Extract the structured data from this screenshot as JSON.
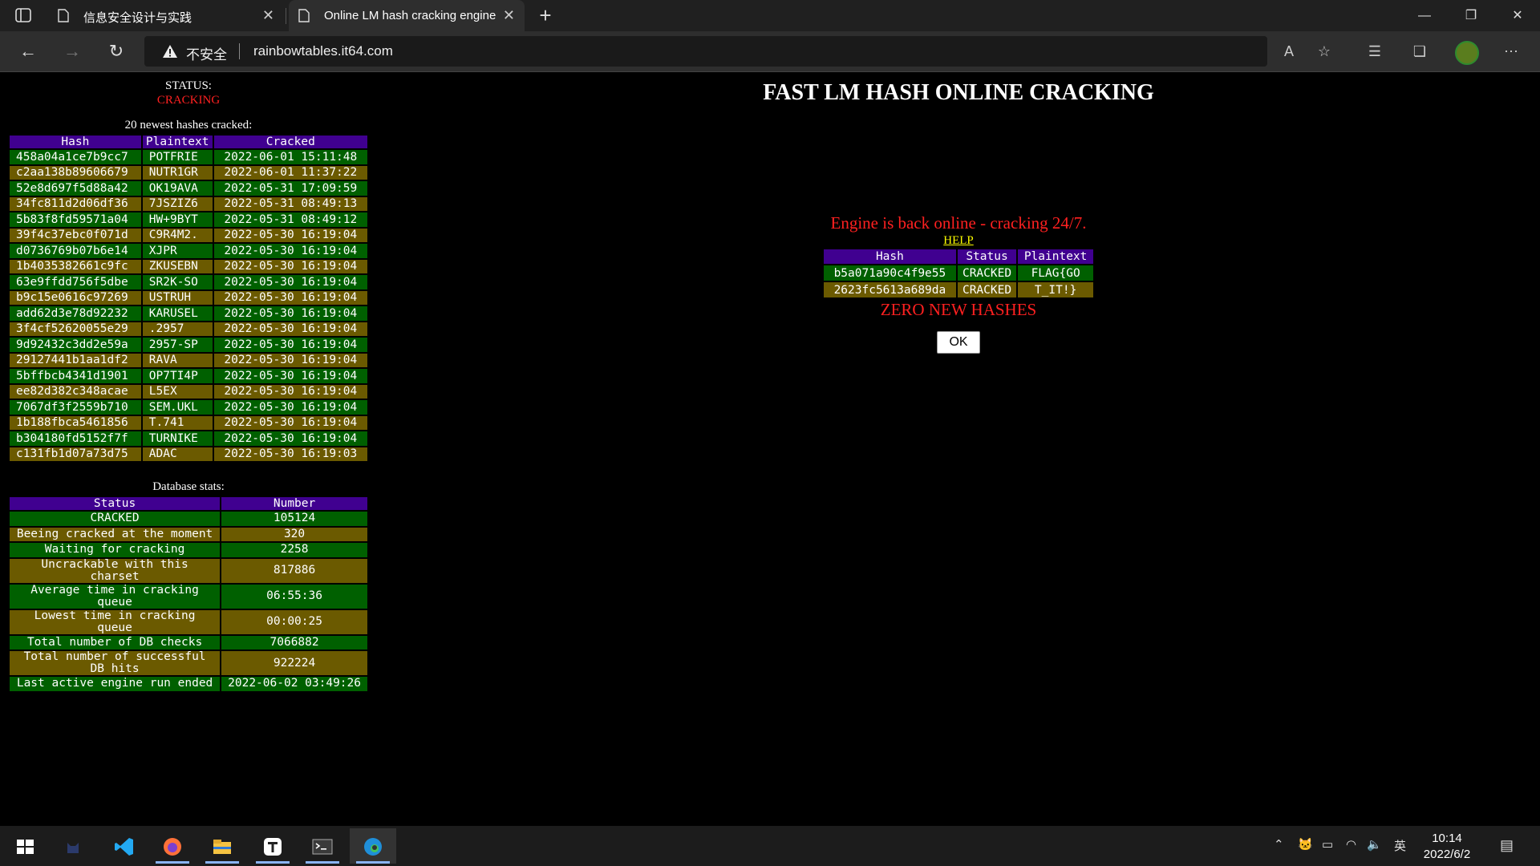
{
  "browser": {
    "tabs": [
      {
        "title": "信息安全设计与实践",
        "active": false
      },
      {
        "title": "Online LM hash cracking engine",
        "active": true
      }
    ],
    "insecure_label": "不安全",
    "url": "rainbowtables.it64.com"
  },
  "page": {
    "status_label": "STATUS:",
    "status_value": "CRACKING",
    "recent_caption": "20 newest hashes cracked:",
    "recent_headers": [
      "Hash",
      "Plaintext",
      "Cracked"
    ],
    "recent_rows": [
      [
        "458a04a1ce7b9cc7",
        "POTFRIE",
        "2022-06-01 15:11:48"
      ],
      [
        "c2aa138b89606679",
        "NUTR1GR",
        "2022-06-01 11:37:22"
      ],
      [
        "52e8d697f5d88a42",
        "OK19AVA",
        "2022-05-31 17:09:59"
      ],
      [
        "34fc811d2d06df36",
        "7JSZIZ6",
        "2022-05-31 08:49:13"
      ],
      [
        "5b83f8fd59571a04",
        "HW+9BYT",
        "2022-05-31 08:49:12"
      ],
      [
        "39f4c37ebc0f071d",
        "C9R4M2.",
        "2022-05-30 16:19:04"
      ],
      [
        "d0736769b07b6e14",
        "XJPR",
        "2022-05-30 16:19:04"
      ],
      [
        "1b4035382661c9fc",
        "ZKUSEBN",
        "2022-05-30 16:19:04"
      ],
      [
        "63e9ffdd756f5dbe",
        "SR2K-SO",
        "2022-05-30 16:19:04"
      ],
      [
        "b9c15e0616c97269",
        "USTRUH",
        "2022-05-30 16:19:04"
      ],
      [
        "add62d3e78d92232",
        "KARUSEL",
        "2022-05-30 16:19:04"
      ],
      [
        "3f4cf52620055e29",
        ".2957",
        "2022-05-30 16:19:04"
      ],
      [
        "9d92432c3dd2e59a",
        "2957-SP",
        "2022-05-30 16:19:04"
      ],
      [
        "29127441b1aa1df2",
        "RAVA",
        "2022-05-30 16:19:04"
      ],
      [
        "5bffbcb4341d1901",
        "OP7TI4P",
        "2022-05-30 16:19:04"
      ],
      [
        "ee82d382c348acae",
        "L5EX",
        "2022-05-30 16:19:04"
      ],
      [
        "7067df3f2559b710",
        "SEM.UKL",
        "2022-05-30 16:19:04"
      ],
      [
        "1b188fbca5461856",
        "T.741",
        "2022-05-30 16:19:04"
      ],
      [
        "b304180fd5152f7f",
        "TURNIKE",
        "2022-05-30 16:19:04"
      ],
      [
        "c131fb1d07a73d75",
        "ADAC",
        "2022-05-30 16:19:03"
      ]
    ],
    "stats_caption": "Database stats:",
    "stats_headers": [
      "Status",
      "Number"
    ],
    "stats_rows": [
      [
        "CRACKED",
        "105124"
      ],
      [
        "Beeing cracked at the moment",
        "320"
      ],
      [
        "Waiting for cracking",
        "2258"
      ],
      [
        "Uncrackable with this charset",
        "817886"
      ],
      [
        "Average time in cracking queue",
        "06:55:36"
      ],
      [
        "Lowest time in cracking queue",
        "00:00:25"
      ],
      [
        "Total number of DB checks",
        "7066882"
      ],
      [
        "Total number of successful DB hits",
        "922224"
      ],
      [
        "Last active engine run ended",
        "2022-06-02 03:49:26"
      ]
    ],
    "title": "FAST LM HASH ONLINE CRACKING",
    "engine_message": "Engine is back online - cracking 24/7.",
    "help_link": "HELP",
    "result_headers": [
      "Hash",
      "Status",
      "Plaintext"
    ],
    "result_rows": [
      [
        "b5a071a90c4f9e55",
        "CRACKED",
        "FLAG{GO"
      ],
      [
        "2623fc5613a689da",
        "CRACKED",
        "T_IT!}"
      ]
    ],
    "zero_message": "ZERO NEW HASHES",
    "ok_button": "OK"
  },
  "taskbar": {
    "apps": [
      "start-icon",
      "cat-app-icon",
      "vscode-icon",
      "firefox-icon",
      "file-explorer-icon",
      "typora-icon",
      "terminal-icon",
      "edge-icon"
    ],
    "ime": "英",
    "time": "10:14",
    "date": "2022/6/2"
  },
  "colors": {
    "row_green": "#006000",
    "row_olive": "#6b5a00",
    "header_purple": "#400090",
    "alert_red": "#ff2020",
    "link_yellow": "#ffff00"
  }
}
